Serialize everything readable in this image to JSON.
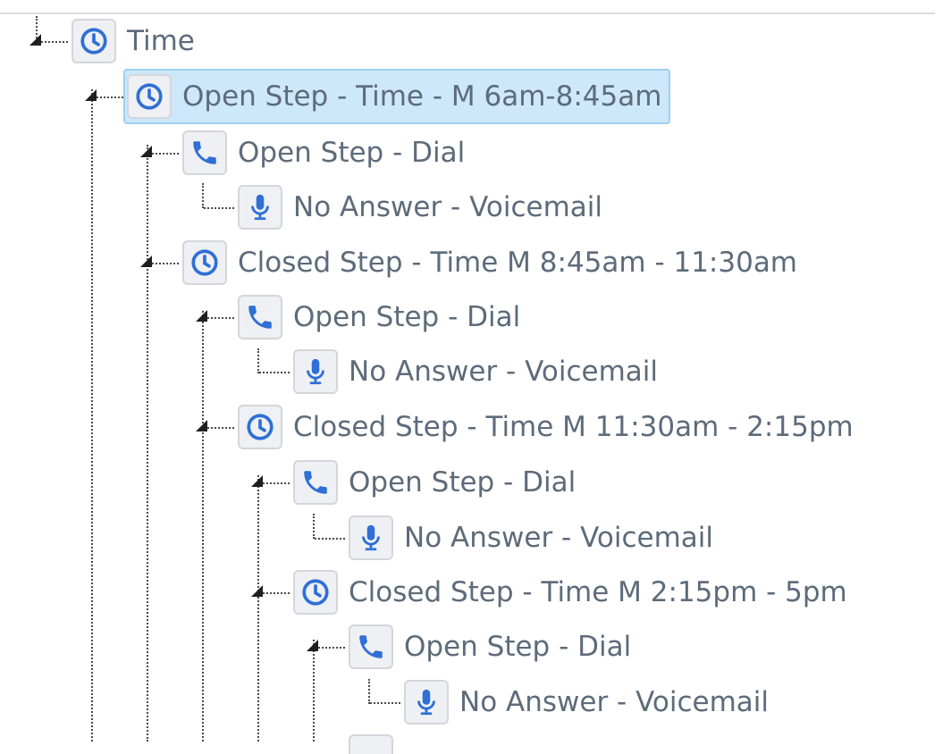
{
  "icon_color": "#2f6fd6",
  "tree": [
    {
      "label": "Time",
      "icon": "clock-icon"
    },
    {
      "label": "Open Step - Time - M 6am-8:45am",
      "icon": "clock-icon",
      "selected": true
    },
    {
      "label": "Open Step - Dial",
      "icon": "phone-icon"
    },
    {
      "label": "No Answer - Voicemail",
      "icon": "microphone-icon"
    },
    {
      "label": "Closed Step - Time M 8:45am - 11:30am",
      "icon": "clock-icon"
    },
    {
      "label": "Open Step - Dial",
      "icon": "phone-icon"
    },
    {
      "label": "No Answer - Voicemail",
      "icon": "microphone-icon"
    },
    {
      "label": "Closed Step - Time M 11:30am - 2:15pm",
      "icon": "clock-icon"
    },
    {
      "label": "Open Step - Dial",
      "icon": "phone-icon"
    },
    {
      "label": "No Answer - Voicemail",
      "icon": "microphone-icon"
    },
    {
      "label": "Closed Step - Time M 2:15pm - 5pm",
      "icon": "clock-icon"
    },
    {
      "label": "Open Step - Dial",
      "icon": "phone-icon"
    },
    {
      "label": "No Answer - Voicemail",
      "icon": "microphone-icon"
    }
  ]
}
